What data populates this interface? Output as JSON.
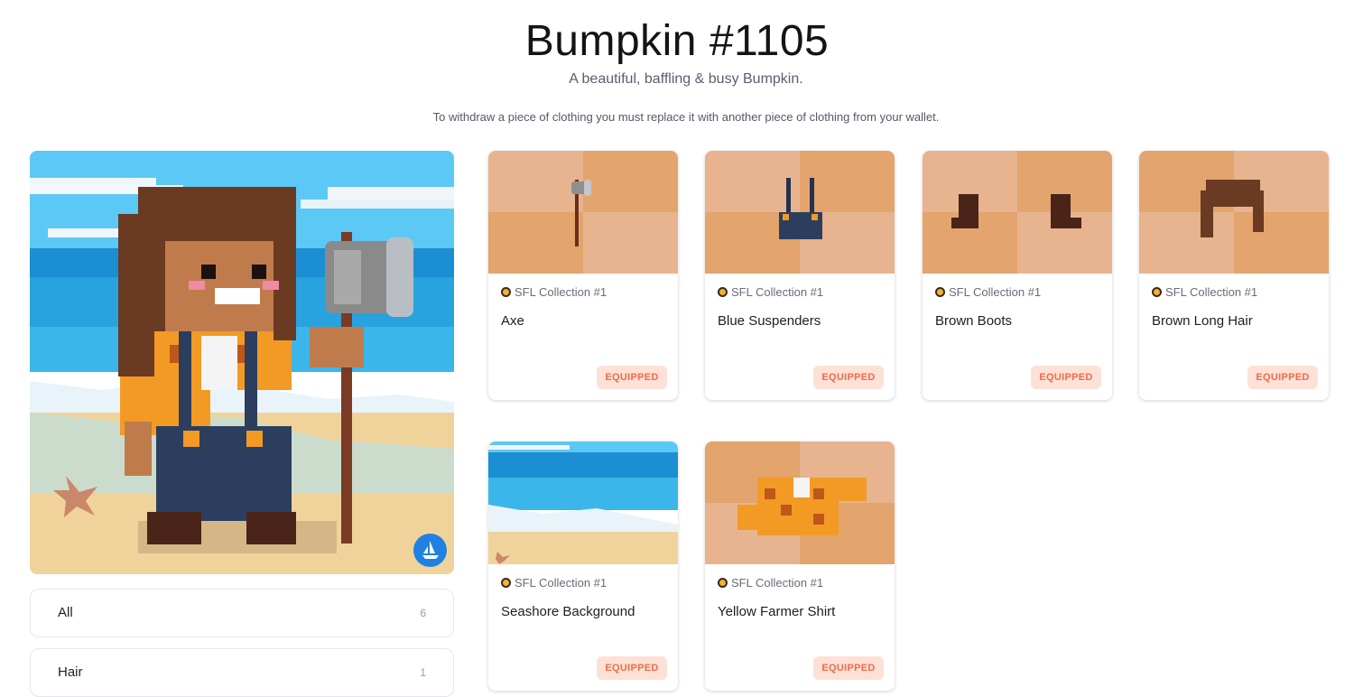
{
  "header": {
    "title": "Bumpkin #1105",
    "subtitle": "A beautiful, baffling & busy Bumpkin.",
    "note": "To withdraw a piece of clothing you must replace it with another piece of clothing from your wallet."
  },
  "hero": {
    "image": "pixel-art-bumpkin-character-on-beach",
    "marketplace_icon": "opensea-icon"
  },
  "filters": [
    {
      "label": "All",
      "count": "6"
    },
    {
      "label": "Hair",
      "count": "1"
    }
  ],
  "items": [
    {
      "collection": "SFL Collection #1",
      "name": "Axe",
      "status": "EQUIPPED",
      "icon": "axe-icon"
    },
    {
      "collection": "SFL Collection #1",
      "name": "Blue Suspenders",
      "status": "EQUIPPED",
      "icon": "suspenders-icon"
    },
    {
      "collection": "SFL Collection #1",
      "name": "Brown Boots",
      "status": "EQUIPPED",
      "icon": "boots-icon"
    },
    {
      "collection": "SFL Collection #1",
      "name": "Brown Long Hair",
      "status": "EQUIPPED",
      "icon": "hair-icon"
    },
    {
      "collection": "SFL Collection #1",
      "name": "Seashore Background",
      "status": "EQUIPPED",
      "icon": "seashore-icon"
    },
    {
      "collection": "SFL Collection #1",
      "name": "Yellow Farmer Shirt",
      "status": "EQUIPPED",
      "icon": "shirt-icon"
    }
  ],
  "colors": {
    "badge_bg": "#fde1d6",
    "badge_text": "#f06b4a",
    "thumb_light": "#e7b48f",
    "thumb_dark": "#e3a46d",
    "opensea": "#2081e2"
  }
}
